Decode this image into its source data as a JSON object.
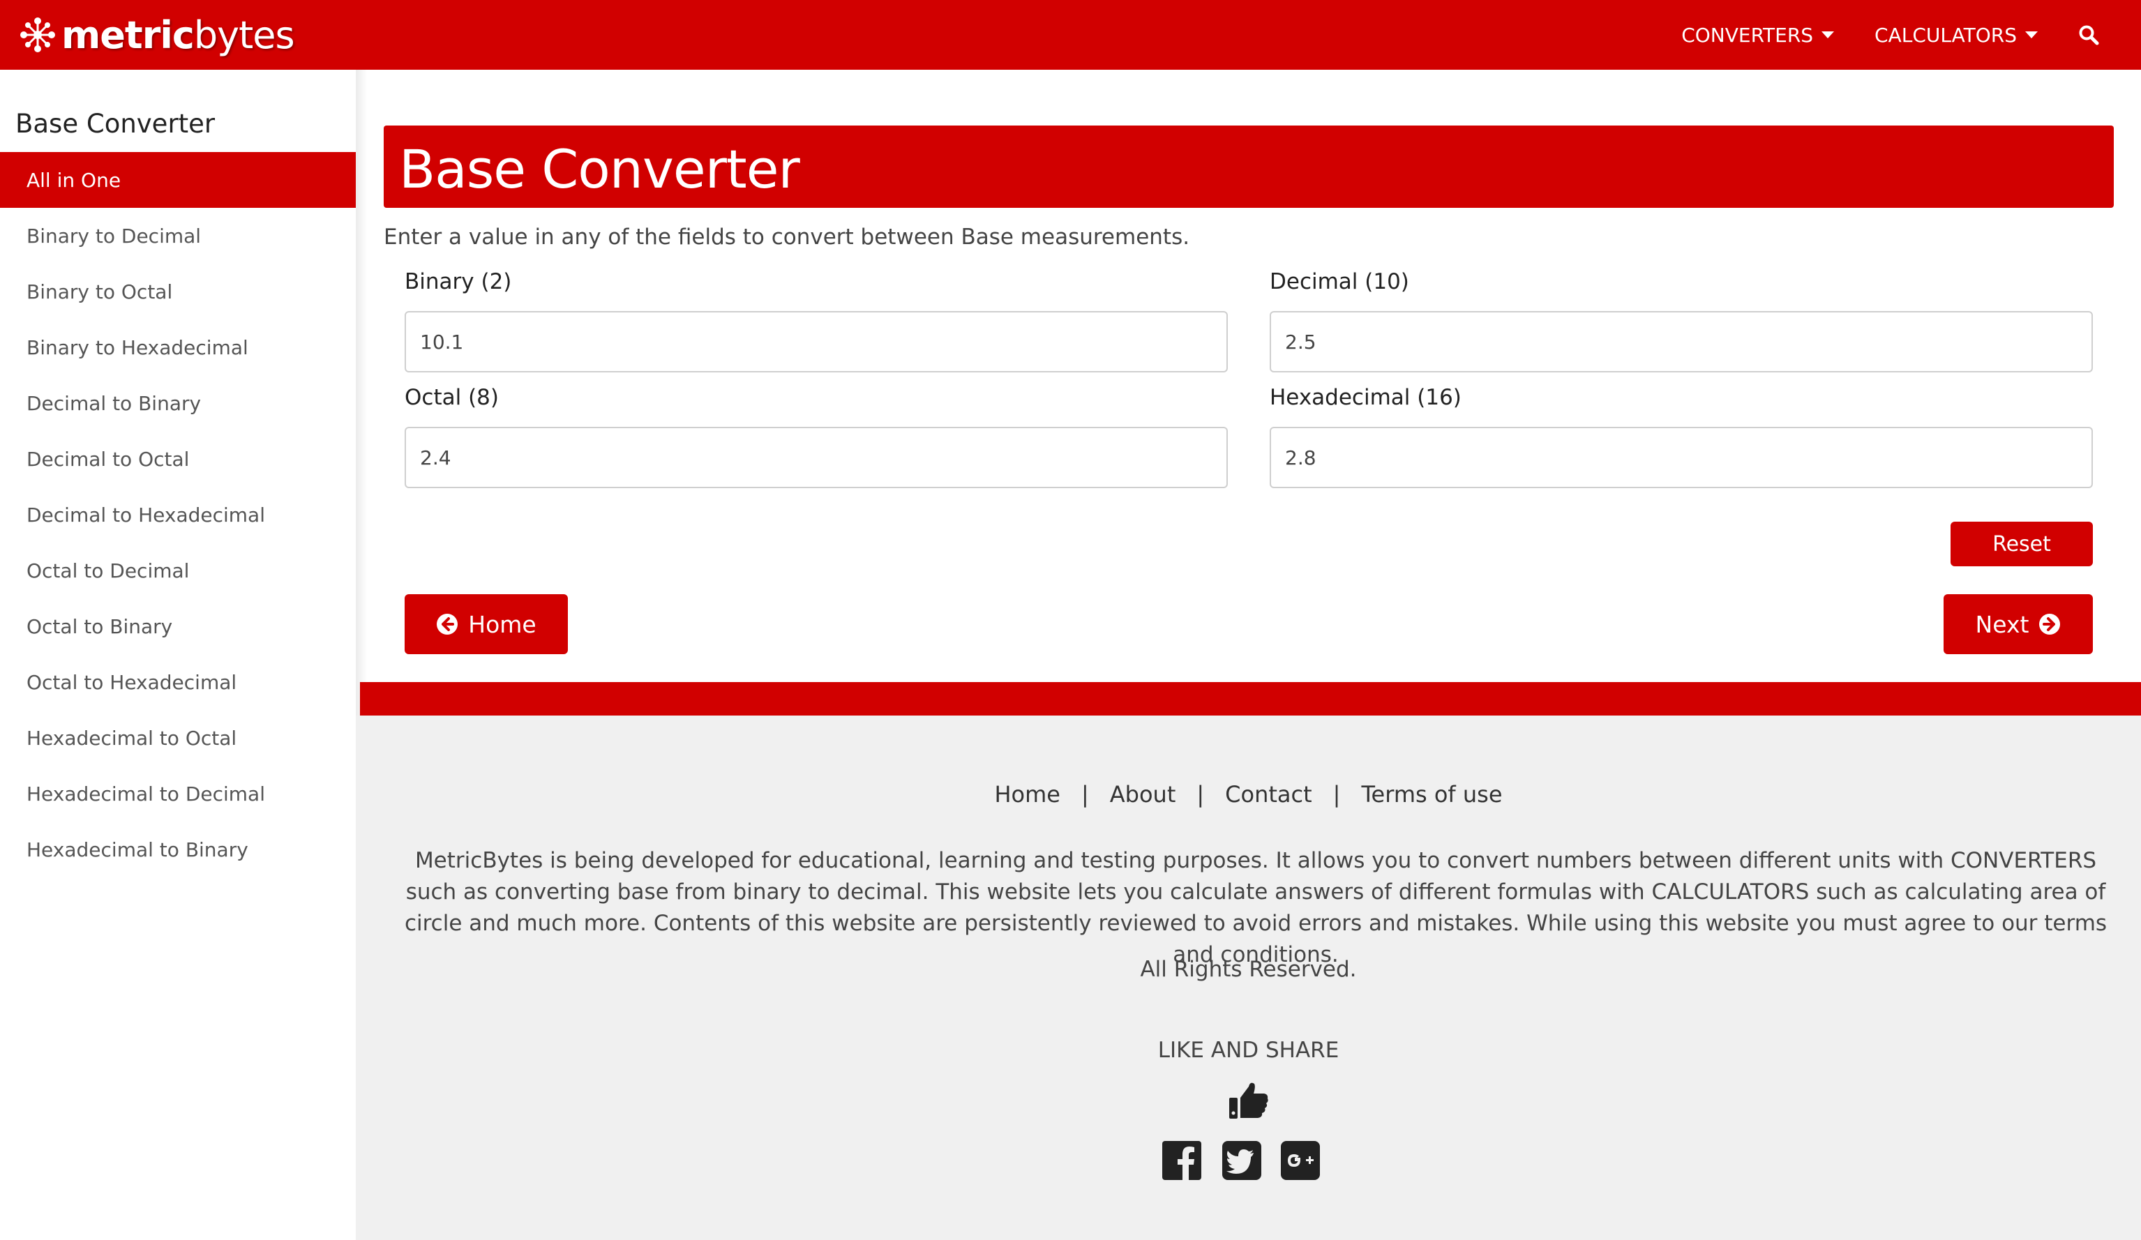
{
  "brand": {
    "name_part1": "metric",
    "name_part2": "bytes",
    "accent_color": "#d10000"
  },
  "nav": {
    "converters": "CONVERTERS",
    "calculators": "CALCULATORS",
    "search_icon": "search-icon"
  },
  "sidebar": {
    "title": "Base Converter",
    "items": [
      {
        "label": "All in One",
        "active": true
      },
      {
        "label": "Binary to Decimal"
      },
      {
        "label": "Binary to Octal"
      },
      {
        "label": "Binary to Hexadecimal"
      },
      {
        "label": "Decimal to Binary"
      },
      {
        "label": "Decimal to Octal"
      },
      {
        "label": "Decimal to Hexadecimal"
      },
      {
        "label": "Octal to Decimal"
      },
      {
        "label": "Octal to Binary"
      },
      {
        "label": "Octal to Hexadecimal"
      },
      {
        "label": "Hexadecimal to Octal"
      },
      {
        "label": "Hexadecimal to Decimal"
      },
      {
        "label": "Hexadecimal to Binary"
      }
    ]
  },
  "main": {
    "title": "Base Converter",
    "intro": "Enter a value in any of the fields to convert between Base measurements.",
    "fields": {
      "binary": {
        "label": "Binary (2)",
        "value": "10.1"
      },
      "decimal": {
        "label": "Decimal (10)",
        "value": "2.5"
      },
      "octal": {
        "label": "Octal (8)",
        "value": "2.4"
      },
      "hex": {
        "label": "Hexadecimal (16)",
        "value": "2.8"
      }
    },
    "reset_label": "Reset",
    "home_label": "Home",
    "next_label": "Next"
  },
  "footer": {
    "links": {
      "home": "Home",
      "about": "About",
      "contact": "Contact",
      "terms": "Terms of use"
    },
    "separator": "|",
    "description": "MetricBytes is being developed for educational, learning and testing purposes. It allows you to convert numbers between different units with CONVERTERS such as converting base from binary to decimal. This website lets you calculate answers of different formulas with CALCULATORS such as calculating area of circle and much more. Contents of this website are persistently reviewed to avoid errors and mistakes. While using this website you must agree to our terms and conditions.",
    "rights": "All Rights Reserved.",
    "like_share": "LIKE AND SHARE",
    "icons": [
      "thumbs-up-icon",
      "facebook-icon",
      "twitter-icon",
      "google-plus-icon"
    ]
  }
}
